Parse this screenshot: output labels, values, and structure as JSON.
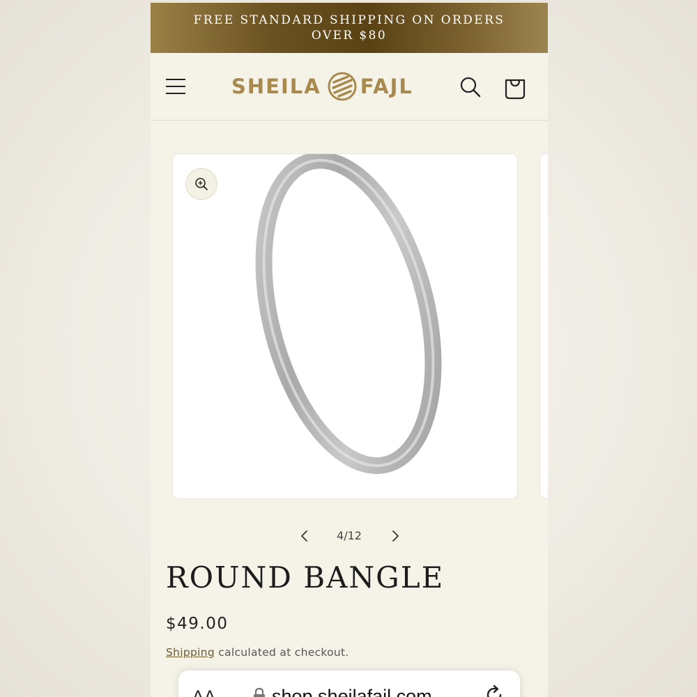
{
  "promo": {
    "line1": "FREE STANDARD SHIPPING ON ORDERS",
    "line2": "OVER $80"
  },
  "header": {
    "logo_left": "SHEILA",
    "logo_right": "FAJL",
    "icons": [
      "menu-icon",
      "logo-mark-icon",
      "search-icon",
      "cart-icon"
    ]
  },
  "gallery": {
    "current": "4/12",
    "icons": [
      "zoom-in-icon",
      "chevron-left-icon",
      "chevron-right-icon"
    ]
  },
  "product": {
    "title": "ROUND BANGLE",
    "price": "$49.00",
    "shipping_link": "Shipping",
    "shipping_note": " calculated at checkout."
  },
  "browser": {
    "aa_label": "AA",
    "url": "shop.sheilafajl.com",
    "icons": [
      "lock-icon",
      "reload-icon"
    ]
  },
  "colors": {
    "brand_gold": "#a88a4e",
    "promo_dark": "#5a4214",
    "page_bg": "#f5f2e8"
  }
}
